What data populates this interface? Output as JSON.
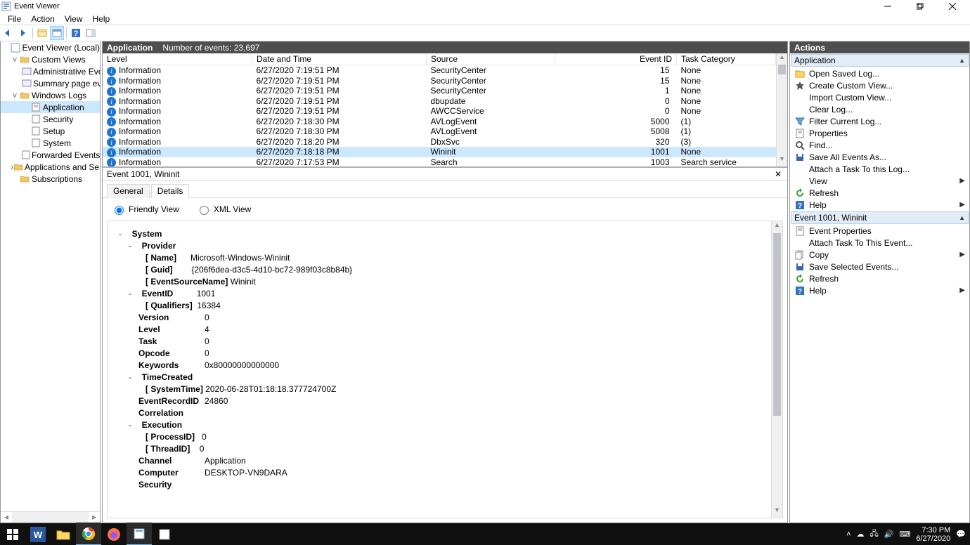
{
  "window": {
    "title": "Event Viewer"
  },
  "menu": [
    "File",
    "Action",
    "View",
    "Help"
  ],
  "tree": {
    "root": "Event Viewer (Local)",
    "custom_views": "Custom Views",
    "admin_events": "Administrative Events",
    "summary": "Summary page events",
    "windows_logs": "Windows Logs",
    "application": "Application",
    "security": "Security",
    "setup": "Setup",
    "system": "System",
    "forwarded": "Forwarded Events",
    "app_services": "Applications and Services Lo",
    "subscriptions": "Subscriptions"
  },
  "centerHeader": {
    "name": "Application",
    "count": "Number of events: 23,697"
  },
  "columns": {
    "level": "Level",
    "date": "Date and Time",
    "source": "Source",
    "eid": "Event ID",
    "task": "Task Category"
  },
  "events": [
    {
      "level": "Information",
      "date": "6/27/2020 7:19:51 PM",
      "source": "SecurityCenter",
      "eid": "15",
      "task": "None"
    },
    {
      "level": "Information",
      "date": "6/27/2020 7:19:51 PM",
      "source": "SecurityCenter",
      "eid": "15",
      "task": "None"
    },
    {
      "level": "Information",
      "date": "6/27/2020 7:19:51 PM",
      "source": "SecurityCenter",
      "eid": "1",
      "task": "None"
    },
    {
      "level": "Information",
      "date": "6/27/2020 7:19:51 PM",
      "source": "dbupdate",
      "eid": "0",
      "task": "None"
    },
    {
      "level": "Information",
      "date": "6/27/2020 7:19:51 PM",
      "source": "AWCCService",
      "eid": "0",
      "task": "None"
    },
    {
      "level": "Information",
      "date": "6/27/2020 7:18:30 PM",
      "source": "AVLogEvent",
      "eid": "5000",
      "task": "(1)"
    },
    {
      "level": "Information",
      "date": "6/27/2020 7:18:30 PM",
      "source": "AVLogEvent",
      "eid": "5008",
      "task": "(1)"
    },
    {
      "level": "Information",
      "date": "6/27/2020 7:18:20 PM",
      "source": "DbxSvc",
      "eid": "320",
      "task": "(3)"
    },
    {
      "level": "Information",
      "date": "6/27/2020 7:18:18 PM",
      "source": "Wininit",
      "eid": "1001",
      "task": "None",
      "sel": true
    },
    {
      "level": "Information",
      "date": "6/27/2020 7:17:53 PM",
      "source": "Search",
      "eid": "1003",
      "task": "Search service"
    }
  ],
  "detail": {
    "title": "Event 1001, Wininit",
    "tabs": {
      "general": "General",
      "details": "Details"
    },
    "views": {
      "friendly": "Friendly View",
      "xml": "XML View"
    },
    "system_label": "System",
    "provider_label": "Provider",
    "provider": {
      "Name": "Microsoft-Windows-Wininit",
      "Guid": "{206f6dea-d3c5-4d10-bc72-989f03c8b84b}",
      "EventSourceName": "Wininit"
    },
    "eventid_label": "EventID",
    "eventid": "1001",
    "qualifiers_label": "Qualifiers",
    "qualifiers": "16384",
    "version_label": "Version",
    "version": "0",
    "level_label": "Level",
    "level": "4",
    "task_label": "Task",
    "task": "0",
    "opcode_label": "Opcode",
    "opcode": "0",
    "keywords_label": "Keywords",
    "keywords": "0x80000000000000",
    "timecreated_label": "TimeCreated",
    "systemtime_label": "SystemTime",
    "systemtime": "2020-06-28T01:18:18.377724700Z",
    "recordid_label": "EventRecordID",
    "recordid": "24860",
    "correlation_label": "Correlation",
    "execution_label": "Execution",
    "processid_label": "ProcessID",
    "processid": "0",
    "threadid_label": "ThreadID",
    "threadid": "0",
    "channel_label": "Channel",
    "channel": "Application",
    "computer_label": "Computer",
    "computer": "DESKTOP-VN9DARA",
    "security_label": "Security"
  },
  "actions": {
    "header": "Actions",
    "group1": "Application",
    "items1": [
      "Open Saved Log...",
      "Create Custom View...",
      "Import Custom View...",
      "Clear Log...",
      "Filter Current Log...",
      "Properties",
      "Find...",
      "Save All Events As...",
      "Attach a Task To this Log...",
      "View",
      "Refresh",
      "Help"
    ],
    "group2": "Event 1001, Wininit",
    "items2": [
      "Event Properties",
      "Attach Task To This Event...",
      "Copy",
      "Save Selected Events...",
      "Refresh",
      "Help"
    ]
  },
  "taskbar": {
    "time": "7:30 PM",
    "date": "6/27/2020"
  }
}
